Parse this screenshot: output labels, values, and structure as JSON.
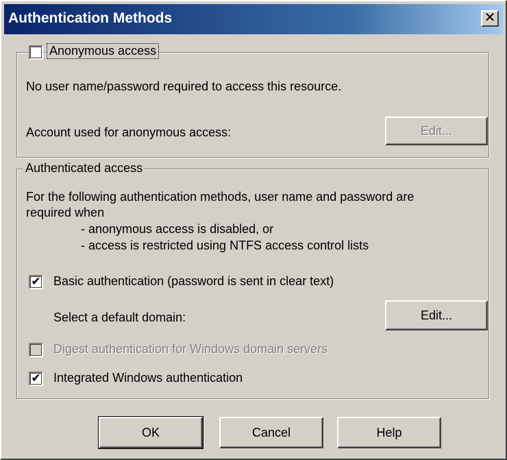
{
  "window": {
    "title": "Authentication Methods",
    "close_glyph": "✕"
  },
  "anonymous": {
    "checkbox_label": "Anonymous access",
    "checked": false,
    "description": "No user name/password required to access this resource.",
    "account_label": "Account used for anonymous access:",
    "edit_label": "Edit..."
  },
  "authenticated": {
    "legend": "Authenticated access",
    "desc_line1": "For the following authentication methods, user name and password are",
    "desc_line2": "required when",
    "desc_bullet1": "- anonymous access is disabled, or",
    "desc_bullet2": "- access is restricted using NTFS access control lists",
    "basic_label": "Basic authentication (password is sent in clear text)",
    "basic_checked": true,
    "domain_label": "Select a default domain:",
    "edit_label": "Edit...",
    "digest_label": "Digest authentication for Windows domain servers",
    "digest_checked": false,
    "integrated_label": "Integrated Windows authentication",
    "integrated_checked": true,
    "check_glyph": "✔"
  },
  "buttons": {
    "ok": "OK",
    "cancel": "Cancel",
    "help": "Help"
  }
}
